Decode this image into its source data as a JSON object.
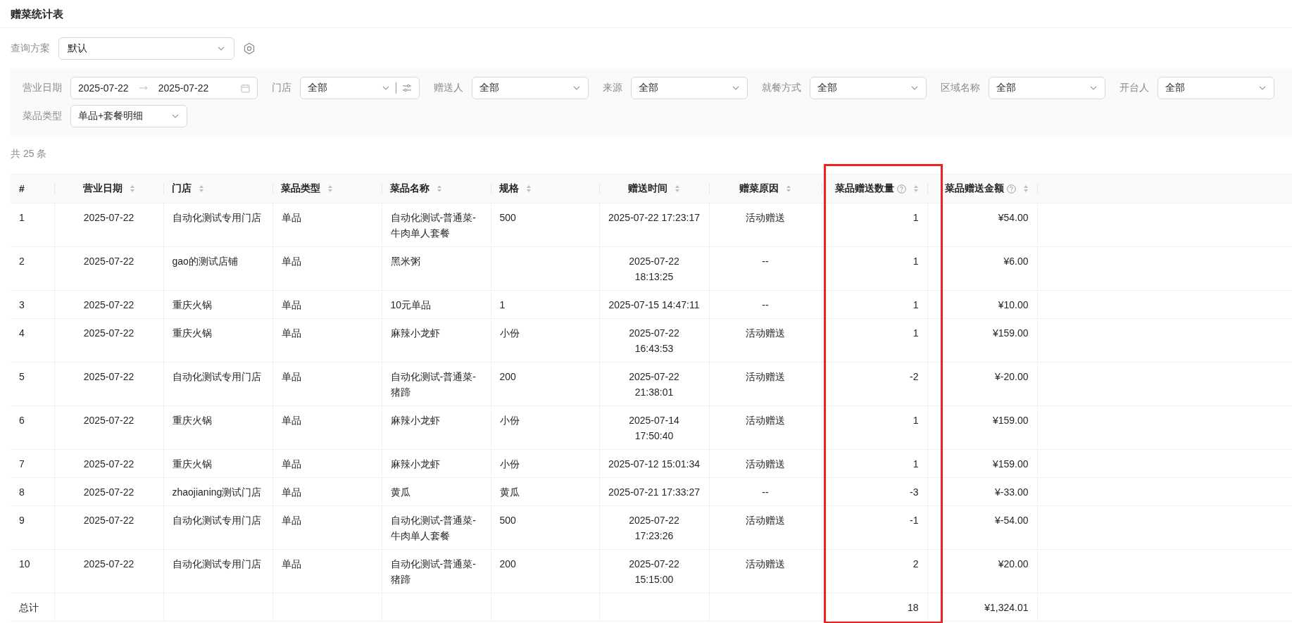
{
  "page_title": "赠菜统计表",
  "query_scheme": {
    "label": "查询方案",
    "value": "默认"
  },
  "filters": [
    {
      "label": "营业日期",
      "kind": "date-range",
      "start": "2025-07-22",
      "end": "2025-07-22"
    },
    {
      "label": "门店",
      "kind": "select-extra",
      "value": "全部"
    },
    {
      "label": "赠送人",
      "kind": "select",
      "value": "全部"
    },
    {
      "label": "来源",
      "kind": "select",
      "value": "全部"
    },
    {
      "label": "就餐方式",
      "kind": "select",
      "value": "全部"
    },
    {
      "label": "区域名称",
      "kind": "select",
      "value": "全部"
    },
    {
      "label": "开台人",
      "kind": "select",
      "value": "全部"
    },
    {
      "label": "菜品类型",
      "kind": "select",
      "value": "单品+套餐明细"
    }
  ],
  "total_count": "共 25 条",
  "table": {
    "columns": [
      {
        "label": "#",
        "sortable": false,
        "help": false,
        "highlighted": false
      },
      {
        "label": "营业日期",
        "sortable": true,
        "help": false,
        "highlighted": false
      },
      {
        "label": "门店",
        "sortable": true,
        "help": false,
        "highlighted": false
      },
      {
        "label": "菜品类型",
        "sortable": true,
        "help": false,
        "highlighted": false
      },
      {
        "label": "菜品名称",
        "sortable": true,
        "help": false,
        "highlighted": false
      },
      {
        "label": "规格",
        "sortable": true,
        "help": false,
        "highlighted": false
      },
      {
        "label": "赠送时间",
        "sortable": true,
        "help": false,
        "highlighted": false
      },
      {
        "label": "赠菜原因",
        "sortable": true,
        "help": false,
        "highlighted": false
      },
      {
        "label": "菜品赠送数量",
        "sortable": true,
        "help": true,
        "highlighted": true
      },
      {
        "label": "菜品赠送金额",
        "sortable": true,
        "help": true,
        "highlighted": false
      }
    ],
    "rows": [
      [
        "1",
        "2025-07-22",
        "自动化测试专用门店",
        "单品",
        "自动化测试-普通菜-\n牛肉单人套餐",
        "500",
        "2025-07-22 17:23:17",
        "活动赠送",
        "1",
        "¥54.00"
      ],
      [
        "2",
        "2025-07-22",
        "gao的测试店铺",
        "单品",
        "黑米粥",
        "",
        "2025-07-22\n18:13:25",
        "--",
        "1",
        "¥6.00"
      ],
      [
        "3",
        "2025-07-22",
        "重庆火锅",
        "单品",
        "10元单品",
        "1",
        "2025-07-15 14:47:11",
        "--",
        "1",
        "¥10.00"
      ],
      [
        "4",
        "2025-07-22",
        "重庆火锅",
        "单品",
        "麻辣小龙虾",
        "小份",
        "2025-07-22\n16:43:53",
        "活动赠送",
        "1",
        "¥159.00"
      ],
      [
        "5",
        "2025-07-22",
        "自动化测试专用门店",
        "单品",
        "自动化测试-普通菜-\n猪蹄",
        "200",
        "2025-07-22\n21:38:01",
        "活动赠送",
        "-2",
        "¥-20.00"
      ],
      [
        "6",
        "2025-07-22",
        "重庆火锅",
        "单品",
        "麻辣小龙虾",
        "小份",
        "2025-07-14\n17:50:40",
        "活动赠送",
        "1",
        "¥159.00"
      ],
      [
        "7",
        "2025-07-22",
        "重庆火锅",
        "单品",
        "麻辣小龙虾",
        "小份",
        "2025-07-12 15:01:34",
        "活动赠送",
        "1",
        "¥159.00"
      ],
      [
        "8",
        "2025-07-22",
        "zhaojianing测试门店",
        "单品",
        "黄瓜",
        "黄瓜",
        "2025-07-21 17:33:27",
        "--",
        "-3",
        "¥-33.00"
      ],
      [
        "9",
        "2025-07-22",
        "自动化测试专用门店",
        "单品",
        "自动化测试-普通菜-\n牛肉单人套餐",
        "500",
        "2025-07-22\n17:23:26",
        "活动赠送",
        "-1",
        "¥-54.00"
      ],
      [
        "10",
        "2025-07-22",
        "自动化测试专用门店",
        "单品",
        "自动化测试-普通菜-\n猪蹄",
        "200",
        "2025-07-22\n15:15:00",
        "活动赠送",
        "2",
        "¥20.00"
      ]
    ],
    "summary": {
      "label": "总计",
      "quantity": "18",
      "amount": "¥1,324.01"
    }
  }
}
